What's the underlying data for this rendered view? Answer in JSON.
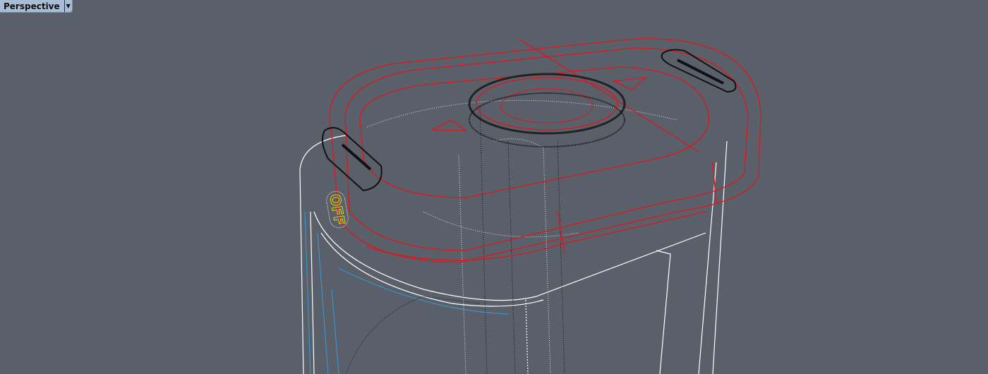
{
  "viewport": {
    "title": "Perspective",
    "menu_icon": "chevron-down-icon"
  },
  "model": {
    "switch_label": "OFF"
  },
  "colors": {
    "background": "#5a606a",
    "selected": "#e0151c",
    "edges": "#ffffff",
    "blue": "#3a9ad9",
    "hidden": "#111111",
    "label": "#e8d000"
  }
}
